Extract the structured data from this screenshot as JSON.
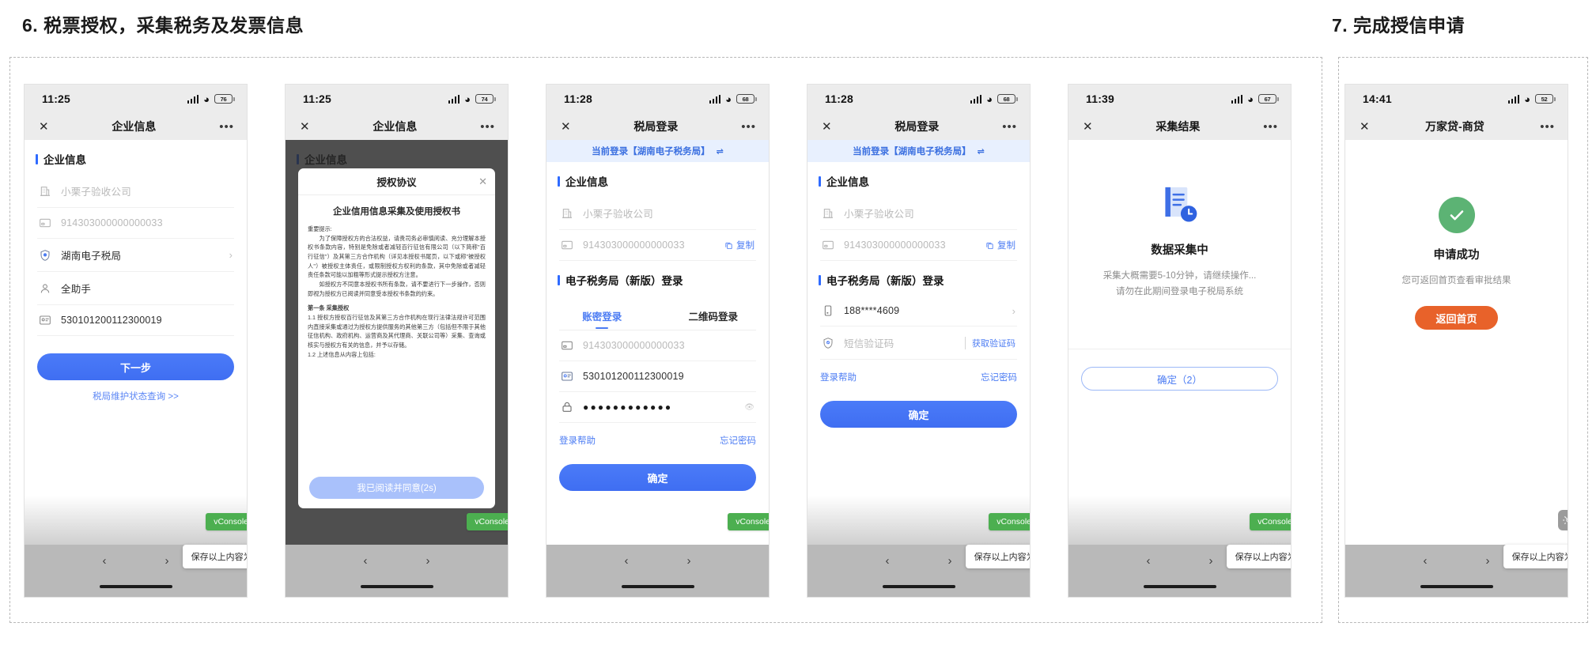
{
  "sections": {
    "step6": "6. 税票授权，采集税务及发票信息",
    "step7": "7. 完成授信申请"
  },
  "colors": {
    "primary_blue": "#4c7cf3",
    "banner_blue": "#e8f0fe",
    "orange": "#e8622a",
    "success_green": "#5cb374",
    "vconsole_green": "#4caf50",
    "statusbar_gray": "#ececec"
  },
  "common": {
    "close_icon": "✕",
    "more_icon": "•••",
    "vconsole_label": "vConsole",
    "save_image_label": "保存以上内容为图片",
    "save_image_chevron": "›",
    "nav_back": "‹",
    "nav_forward": "›"
  },
  "phones": [
    {
      "id": "phone-1",
      "status": {
        "time": "11:25",
        "battery": "76"
      },
      "nav_title": "企业信息",
      "section_label": "企业信息",
      "rows": [
        {
          "icon": "building-icon",
          "value": "小栗子验收公司",
          "muted": true
        },
        {
          "icon": "card-icon",
          "value": "914303000000000033",
          "muted": true
        },
        {
          "icon": "shield-icon",
          "value": "湖南电子税局",
          "muted": false,
          "chevron": "›"
        },
        {
          "icon": "person-icon",
          "value": "全助手",
          "muted": false
        },
        {
          "icon": "idcard-icon",
          "value": "530101200112300019",
          "muted": false
        }
      ],
      "primary_button": "下一步",
      "link": "税局维护状态查询 >>"
    },
    {
      "id": "phone-2",
      "status": {
        "time": "11:25",
        "battery": "74"
      },
      "nav_title": "企业信息",
      "modal": {
        "title": "授权协议",
        "close": "✕",
        "doc_title": "企业信用信息采集及使用授权书",
        "p1_label": "重要提示:",
        "p1": "　　为了保障授权方的合法权益，请贵司务必审慎阅读、充分理解本授权书条款内容，特别是免除或者减轻百行征信有限公司（以下简称\"百行征信\"）及其第三方合作机构（详见本授权书尾页，以下或称\"被授权人\"）被授权主体责任，或限制授权方权利的条款，其中免除或者减轻责任条款可能以加粗等形式提示授权方注意。",
        "p2_underline": "　　如授权方不同意本授权书所有条款，请不要进行下一步操作，否则即视为授权方已阅读并同意受本授权书条款的约束。",
        "clause_title": "第一条 采集授权",
        "p3": "1.1 授权方授权百行征信及其第三方合作机构在现行法律法规许可范围内直接采集或通过为授权方提供服务的其他第三方（包括但不限于其他征信机构、政府机构、运营商及其代理商、关联公司等）采集、查询或核实与授权方有关的信息，并予以存储。",
        "p4": "1.2 上述信息从内容上包括:",
        "agree_button": "我已阅读并同意(2s)"
      }
    },
    {
      "id": "phone-3",
      "status": {
        "time": "11:28",
        "battery": "68"
      },
      "nav_title": "税局登录",
      "banner": {
        "text": "当前登录【湖南电子税务局】",
        "swap_icon": "⇌"
      },
      "section_label": "企业信息",
      "rows": [
        {
          "icon": "building-icon",
          "value": "小栗子验收公司",
          "muted": true
        },
        {
          "icon": "card-icon",
          "value": "914303000000000033",
          "muted": true,
          "copy": "复制"
        }
      ],
      "section_label2": "电子税务局（新版）登录",
      "tabs": [
        {
          "label": "账密登录",
          "active": true
        },
        {
          "label": "二维码登录",
          "active": false
        }
      ],
      "form_rows": [
        {
          "icon": "card-icon",
          "value": "914303000000000033",
          "muted": true
        },
        {
          "icon": "idcard-icon",
          "value": "530101200112300019",
          "muted": false
        },
        {
          "icon": "lock-icon",
          "value": "●●●●●●●●●●●●",
          "password": true
        }
      ],
      "help_left": "登录帮助",
      "help_right": "忘记密码",
      "primary_button": "确定"
    },
    {
      "id": "phone-4",
      "status": {
        "time": "11:28",
        "battery": "68"
      },
      "nav_title": "税局登录",
      "banner": {
        "text": "当前登录【湖南电子税务局】",
        "swap_icon": "⇌"
      },
      "section_label": "企业信息",
      "rows": [
        {
          "icon": "building-icon",
          "value": "小栗子验收公司",
          "muted": true
        },
        {
          "icon": "card-icon",
          "value": "914303000000000033",
          "muted": true,
          "copy": "复制"
        }
      ],
      "section_label2": "电子税务局（新版）登录",
      "form_rows": [
        {
          "icon": "phone-icon",
          "value": "188****4609",
          "muted": false,
          "chevron": "›"
        },
        {
          "icon": "shield-check-icon",
          "value": "短信验证码",
          "muted": true,
          "getcode": "获取验证码"
        }
      ],
      "help_left": "登录帮助",
      "help_right": "忘记密码",
      "primary_button": "确定"
    },
    {
      "id": "phone-5",
      "status": {
        "time": "11:39",
        "battery": "67"
      },
      "nav_title": "采集结果",
      "result_title": "数据采集中",
      "result_sub_1": "采集大概需要5-10分钟，请继续操作...",
      "result_sub_2": "请勿在此期间登录电子税局系统",
      "outline_button": "确定（2）"
    },
    {
      "id": "phone-6",
      "status": {
        "time": "14:41",
        "battery": "52"
      },
      "nav_title": "万家贷-商贷",
      "result_title": "申请成功",
      "result_sub_1": "您可返回首页查看审批结果",
      "orange_button": "返回首页"
    }
  ]
}
